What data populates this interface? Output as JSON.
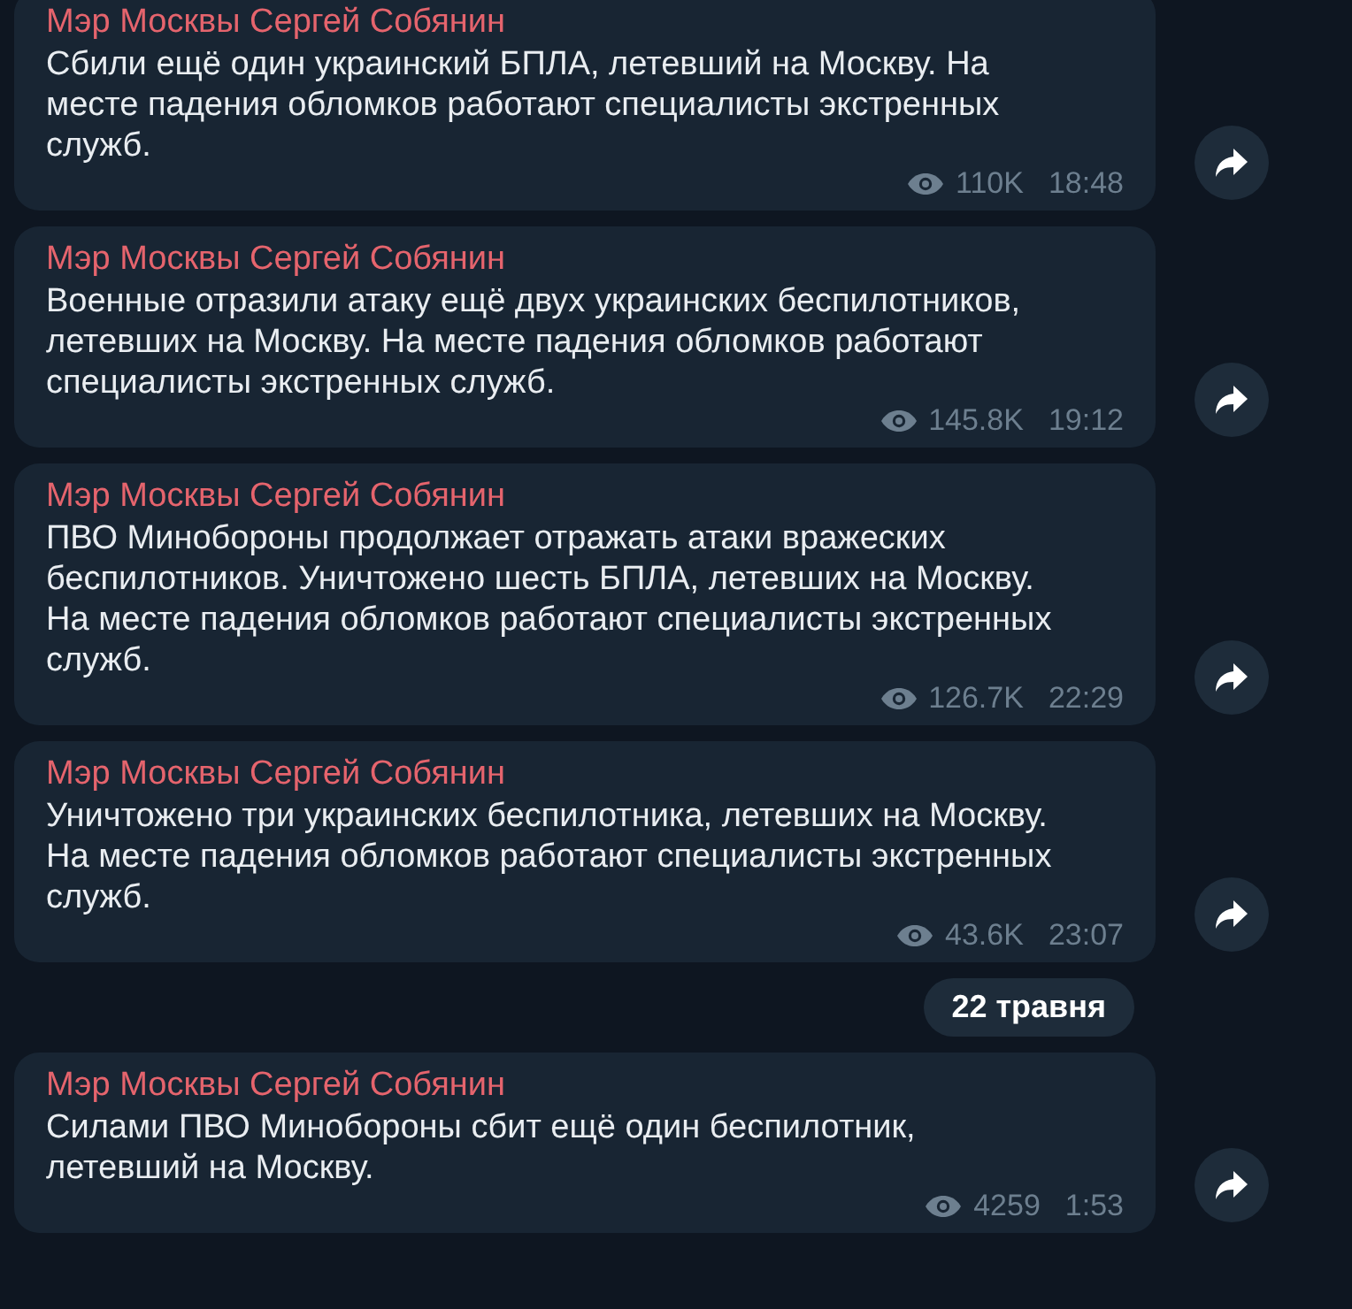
{
  "messages": [
    {
      "kind": "message",
      "author": "Мэр Москвы Сергей Собянин",
      "text": "Сбили ещё один украинский БПЛА, летевший на Москву. На\nместе падения обломков работают специалисты экстренных\nслужб.",
      "views": "110K",
      "time": "18:48"
    },
    {
      "kind": "message",
      "author": "Мэр Москвы Сергей Собянин",
      "text": "Военные отразили атаку ещё двух украинских беспилотников,\nлетевших на Москву. На месте падения обломков работают\nспециалисты экстренных служб.",
      "views": "145.8K",
      "time": "19:12"
    },
    {
      "kind": "message",
      "author": "Мэр Москвы Сергей Собянин",
      "text": "ПВО Минобороны продолжает отражать атаки вражеских\nбеспилотников. Уничтожено шесть БПЛА, летевших на Москву.\nНа месте падения обломков работают специалисты экстренных\nслужб.",
      "views": "126.7K",
      "time": "22:29"
    },
    {
      "kind": "message",
      "author": "Мэр Москвы Сергей Собянин",
      "text": "Уничтожено три украинских беспилотника, летевших на Москву.\nНа месте падения обломков работают специалисты экстренных\nслужб.",
      "views": "43.6K",
      "time": "23:07"
    },
    {
      "kind": "date",
      "text": "22 травня"
    },
    {
      "kind": "message",
      "author": "Мэр Москвы Сергей Собянин",
      "text": "Силами ПВО Минобороны сбит ещё один беспилотник,\nлетевший на Москву.",
      "views": "4259",
      "time": "1:53"
    }
  ]
}
